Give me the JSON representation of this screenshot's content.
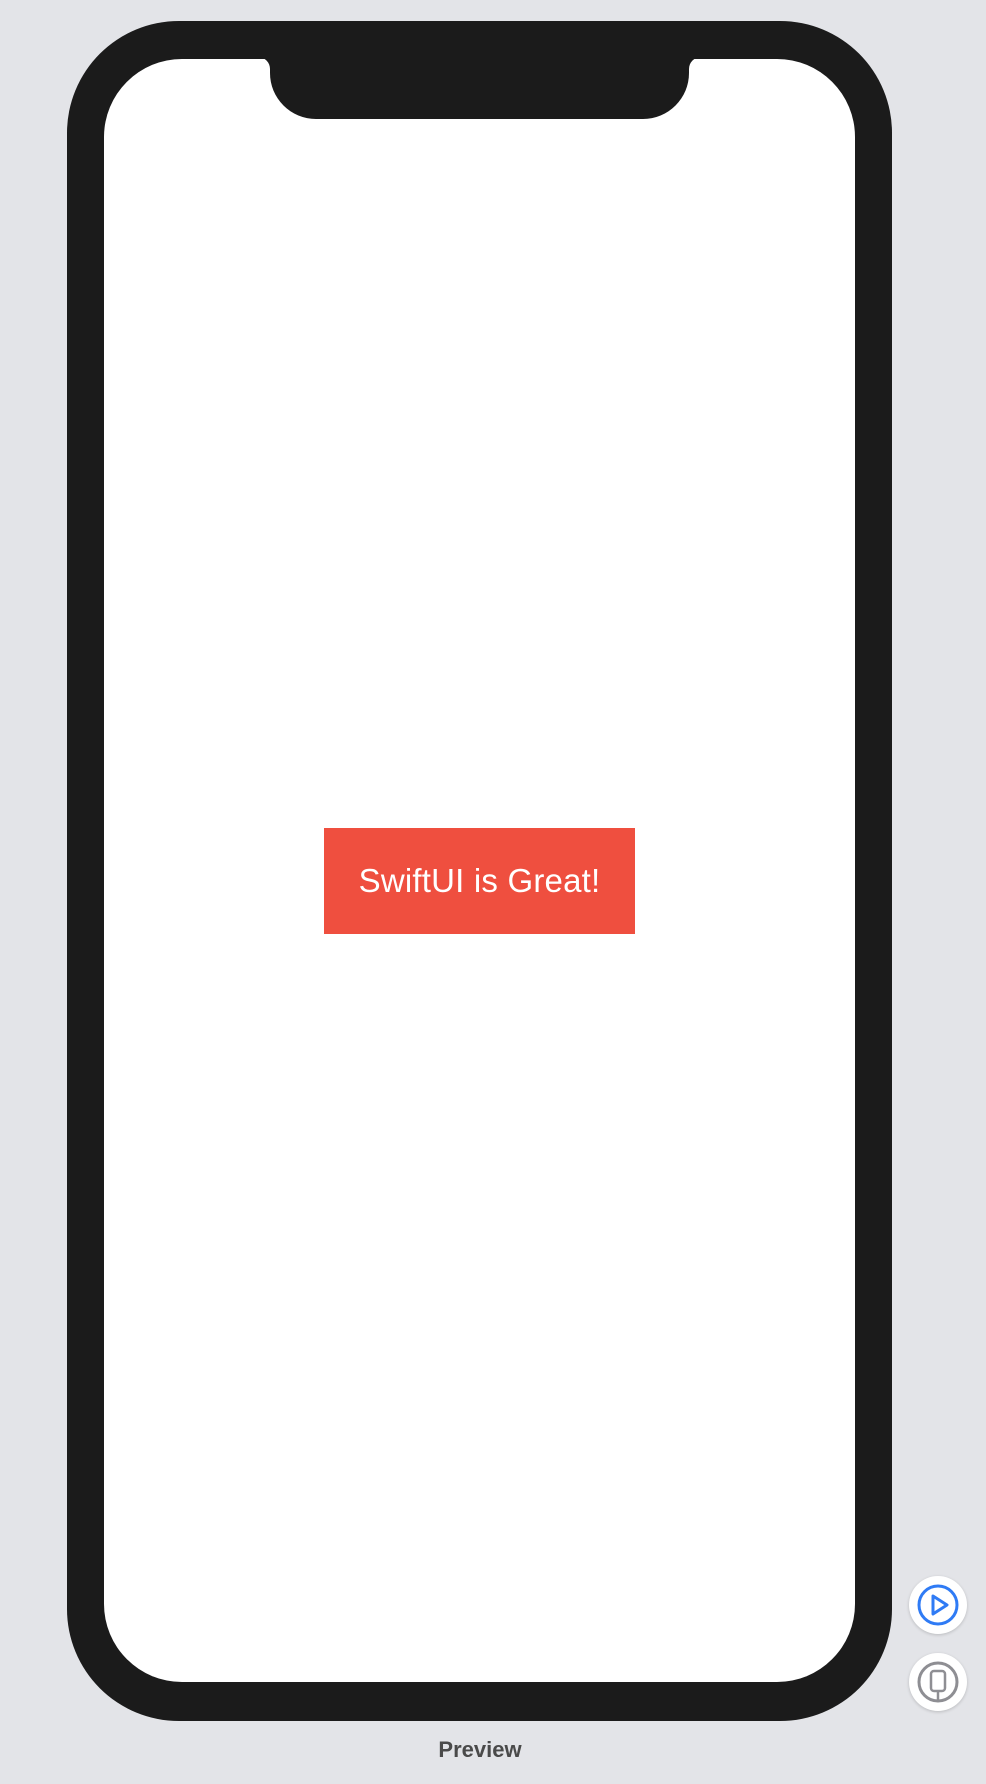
{
  "preview": {
    "text": "SwiftUI is Great!",
    "label_background": "#ef4f3f",
    "label_text_color": "#ffffff",
    "caption": "Preview"
  },
  "colors": {
    "canvas": "#e3e4e8",
    "bezel": "#1b1b1b",
    "screen": "#ffffff",
    "accent": "#2f7bf5"
  },
  "controls": {
    "live_preview_icon": "play-circle-icon",
    "device_preview_icon": "iphone-icon"
  }
}
